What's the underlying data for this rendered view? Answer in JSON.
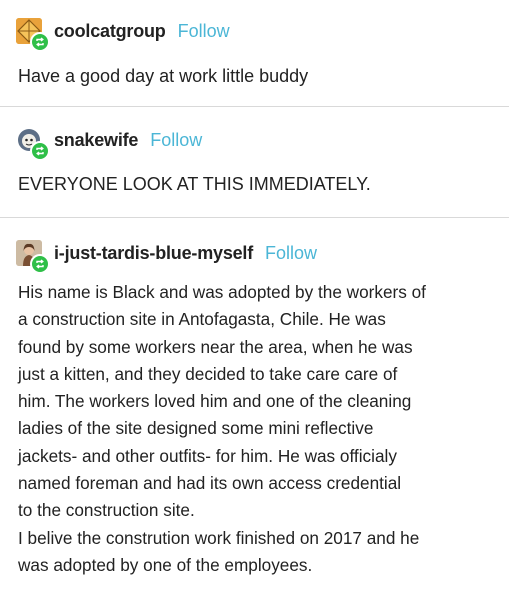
{
  "posts": [
    {
      "username": "coolcatgroup",
      "follow_label": "Follow",
      "text": "Have a good day at work little buddy",
      "avatar_icon": "orange-diamond-avatar-icon"
    },
    {
      "username": "snakewife",
      "follow_label": "Follow",
      "text": "EVERYONE LOOK AT THIS IMMEDIATELY.",
      "avatar_icon": "cartoon-face-avatar-icon"
    },
    {
      "username": "i-just-tardis-blue-myself",
      "follow_label": "Follow",
      "avatar_icon": "person-photo-avatar-icon",
      "lines": [
        "His name is Black and was adopted by the workers of",
        "a construction site in Antofagasta, Chile. He was",
        "found by some workers near the area, when he was",
        "just a kitten, and they decided to take care care of",
        "him.  The workers loved him and one of the cleaning",
        "ladies of the site designed some mini reflective",
        "jackets- and other outfits- for him.  He was officialy",
        "named foreman  and had its own access credential",
        "to the construction site.",
        "I belive the constrution work finished on 2017 and he",
        "was adopted by one of the employees."
      ]
    }
  ],
  "colors": {
    "follow": "#4bb6d6",
    "reblog_badge": "#2fbf48",
    "divider": "#d9d9d9",
    "text": "#222222"
  }
}
